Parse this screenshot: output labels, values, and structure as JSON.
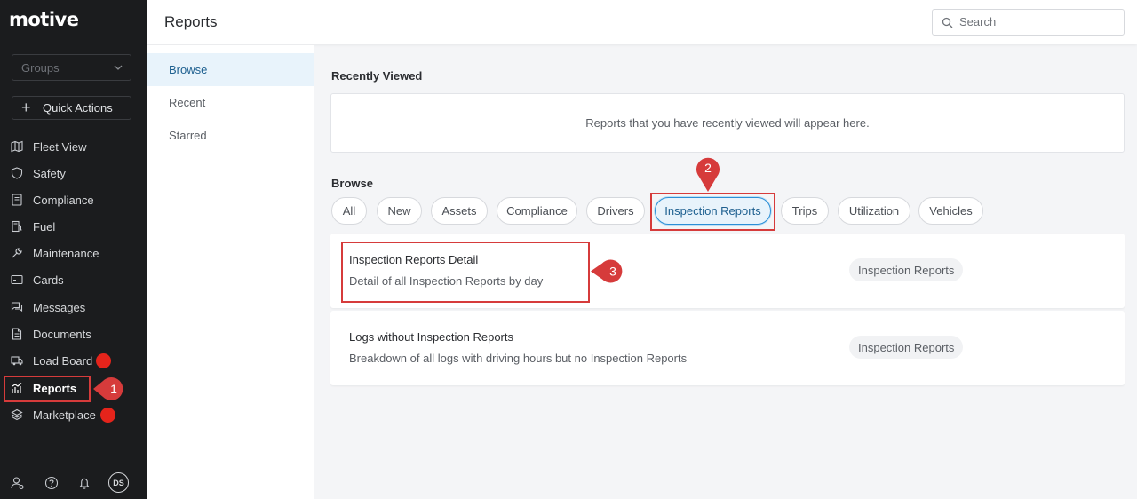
{
  "app": {
    "logo": "motive"
  },
  "sidebar": {
    "groups_placeholder": "Groups",
    "quick_actions": "Quick Actions",
    "items": [
      {
        "label": "Fleet View",
        "icon": "map-icon"
      },
      {
        "label": "Safety",
        "icon": "shield-icon"
      },
      {
        "label": "Compliance",
        "icon": "document-list-icon"
      },
      {
        "label": "Fuel",
        "icon": "fuel-icon"
      },
      {
        "label": "Maintenance",
        "icon": "wrench-icon"
      },
      {
        "label": "Cards",
        "icon": "card-icon"
      },
      {
        "label": "Messages",
        "icon": "messages-icon"
      },
      {
        "label": "Documents",
        "icon": "documents-icon"
      },
      {
        "label": "Load Board",
        "icon": "truck-icon"
      },
      {
        "label": "Reports",
        "icon": "reports-icon"
      },
      {
        "label": "Marketplace",
        "icon": "layers-icon"
      }
    ],
    "avatar_initials": "DS"
  },
  "header": {
    "title": "Reports",
    "search_placeholder": "Search"
  },
  "subnav": {
    "items": [
      "Browse",
      "Recent",
      "Starred"
    ],
    "active": "Browse"
  },
  "main": {
    "recently_viewed_label": "Recently Viewed",
    "recently_viewed_empty": "Reports that you have recently viewed will appear here.",
    "browse_label": "Browse",
    "filters": [
      "All",
      "New",
      "Assets",
      "Compliance",
      "Drivers",
      "Inspection Reports",
      "Trips",
      "Utilization",
      "Vehicles"
    ],
    "active_filter": "Inspection Reports",
    "reports": [
      {
        "title": "Inspection Reports Detail",
        "description": "Detail of all Inspection Reports by day",
        "tag": "Inspection Reports"
      },
      {
        "title": "Logs without Inspection Reports",
        "description": "Breakdown of all logs with driving hours but no Inspection Reports",
        "tag": "Inspection Reports"
      }
    ]
  },
  "annotations": {
    "step1": "1",
    "step2": "2",
    "step3": "3",
    "color": "#d63b3b"
  },
  "colors": {
    "accent": "#2d8fd6",
    "sidebar_bg": "#1b1c1e",
    "dot": "#e5241b"
  }
}
